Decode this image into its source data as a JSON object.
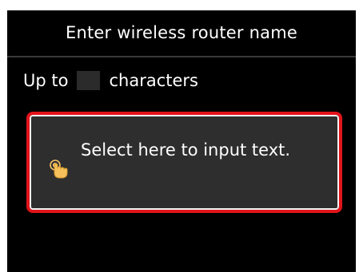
{
  "header": {
    "title": "Enter wireless router name"
  },
  "limit": {
    "prefix": "Up to",
    "count": "",
    "suffix": "characters"
  },
  "input": {
    "prompt": "Select here to input text.",
    "icon": "touch-hand-icon"
  },
  "colors": {
    "background": "#000000",
    "accent_border": "#e0141a",
    "input_fill": "#2e2e2e",
    "text": "#ffffff"
  }
}
